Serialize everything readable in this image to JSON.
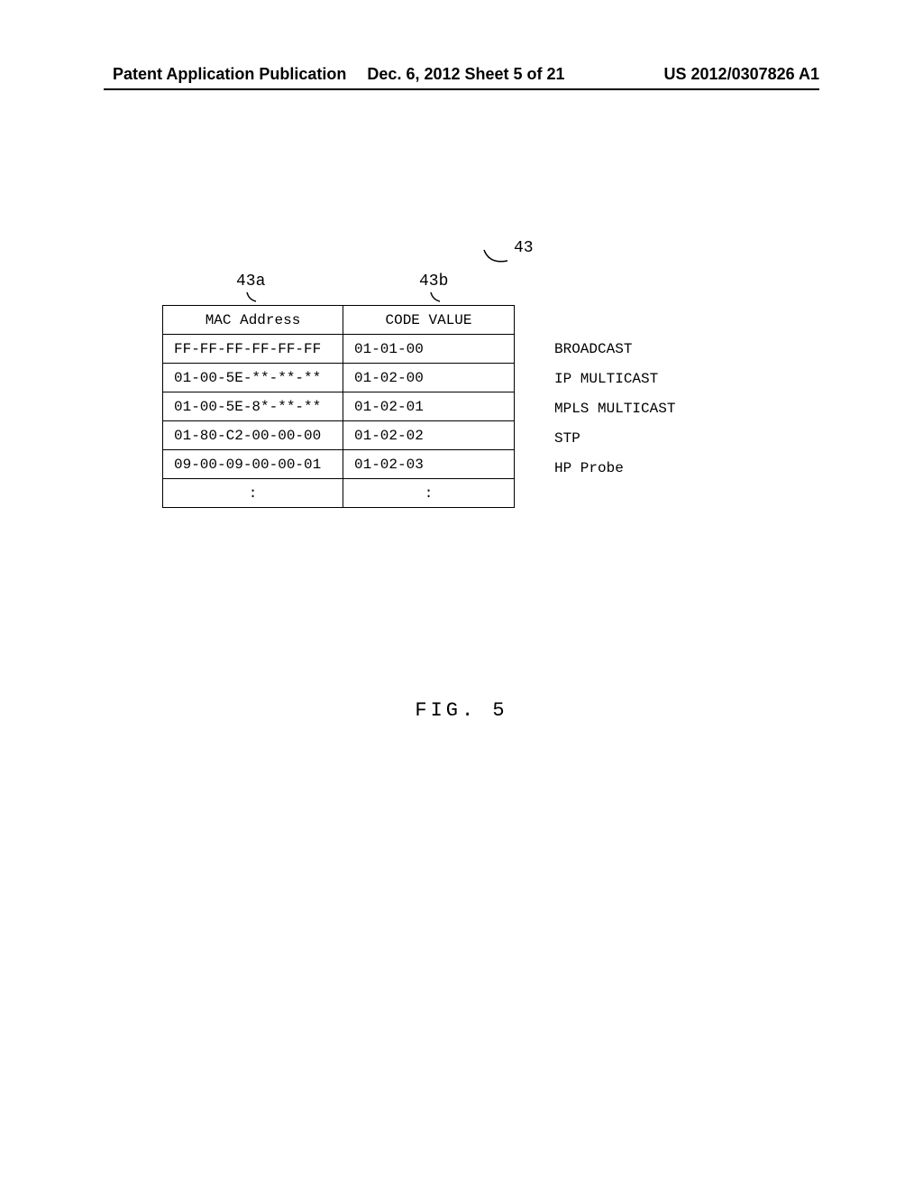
{
  "header": {
    "left": "Patent Application Publication",
    "center": "Dec. 6, 2012   Sheet 5 of 21",
    "right": "US 2012/0307826 A1"
  },
  "callouts": {
    "table": "43",
    "col_a": "43a",
    "col_b": "43b"
  },
  "table": {
    "headers": {
      "mac": "MAC Address",
      "code": "CODE VALUE"
    },
    "rows": [
      {
        "mac": "FF-FF-FF-FF-FF-FF",
        "code": "01-01-00",
        "desc": "BROADCAST"
      },
      {
        "mac": "01-00-5E-**-**-**",
        "code": "01-02-00",
        "desc": "IP MULTICAST"
      },
      {
        "mac": "01-00-5E-8*-**-**",
        "code": "01-02-01",
        "desc": "MPLS MULTICAST"
      },
      {
        "mac": "01-80-C2-00-00-00",
        "code": "01-02-02",
        "desc": "STP"
      },
      {
        "mac": "09-00-09-00-00-01",
        "code": "01-02-03",
        "desc": "HP Probe"
      },
      {
        "mac": ":",
        "code": ":",
        "desc": ""
      }
    ]
  },
  "caption": "FIG. 5",
  "chart_data": {
    "type": "table",
    "title": "FIG. 5",
    "reference_numeral": "43",
    "columns": [
      {
        "ref": "43a",
        "header": "MAC Address"
      },
      {
        "ref": "43b",
        "header": "CODE VALUE"
      }
    ],
    "rows": [
      {
        "mac_address": "FF-FF-FF-FF-FF-FF",
        "code_value": "01-01-00",
        "description": "BROADCAST"
      },
      {
        "mac_address": "01-00-5E-**-**-**",
        "code_value": "01-02-00",
        "description": "IP MULTICAST"
      },
      {
        "mac_address": "01-00-5E-8*-**-**",
        "code_value": "01-02-01",
        "description": "MPLS MULTICAST"
      },
      {
        "mac_address": "01-80-C2-00-00-00",
        "code_value": "01-02-02",
        "description": "STP"
      },
      {
        "mac_address": "09-00-09-00-00-01",
        "code_value": "01-02-03",
        "description": "HP Probe"
      }
    ]
  }
}
